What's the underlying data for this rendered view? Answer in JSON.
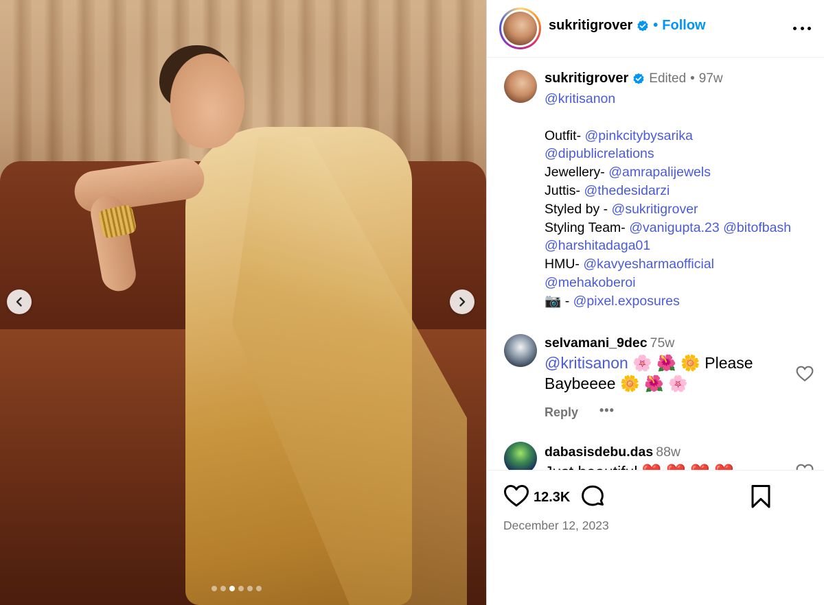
{
  "post": {
    "username": "sukritigrover",
    "follow_label": "Follow",
    "header_separator": "•",
    "caption": {
      "username": "sukritigrover",
      "edited_label": "Edited",
      "separator": "•",
      "age": "97w",
      "lines": [
        [
          {
            "t": "@kritisanon",
            "m": true
          }
        ],
        [
          {
            "t": "",
            "m": false
          }
        ],
        [
          {
            "t": "Outfit- ",
            "m": false
          },
          {
            "t": "@pinkcitybysarika",
            "m": true
          }
        ],
        [
          {
            "t": "@dipublicrelations",
            "m": true
          }
        ],
        [
          {
            "t": "Jewellery- ",
            "m": false
          },
          {
            "t": "@amrapalijewels",
            "m": true
          }
        ],
        [
          {
            "t": "Juttis- ",
            "m": false
          },
          {
            "t": "@thedesidarzi",
            "m": true
          }
        ],
        [
          {
            "t": "Styled by - ",
            "m": false
          },
          {
            "t": "@sukritigrover",
            "m": true
          }
        ],
        [
          {
            "t": "Styling Team- ",
            "m": false
          },
          {
            "t": "@vanigupta.23",
            "m": true
          },
          {
            "t": " ",
            "m": false
          },
          {
            "t": "@bitofbash",
            "m": true
          }
        ],
        [
          {
            "t": "@harshitadaga01",
            "m": true
          }
        ],
        [
          {
            "t": "HMU- ",
            "m": false
          },
          {
            "t": "@kavyesharmaofficial",
            "m": true
          }
        ],
        [
          {
            "t": "@mehakoberoi",
            "m": true
          }
        ],
        [
          {
            "t": "📷 - ",
            "m": false
          },
          {
            "t": "@pixel.exposures",
            "m": true
          }
        ]
      ]
    },
    "comments": [
      {
        "username": "selvamani_9dec",
        "age": "75w",
        "mention": "@kritisanon",
        "text": " 🌸 🌺 🌼 Please Baybeeee 🌼 🌺 🌸",
        "reply_label": "Reply",
        "more_label": "•••"
      },
      {
        "username": "dabasisdebu.das",
        "age": "88w",
        "text": "Just beautiful ❤️ ❤️ ❤️ ❤️"
      }
    ],
    "likes": "12.3K",
    "date": "December 12, 2023",
    "carousel": {
      "count": 6,
      "active_index": 2
    }
  },
  "colors": {
    "link": "#4a5bd8",
    "follow": "#0095f6",
    "muted": "#737373",
    "verified": "#0095f6"
  },
  "icons": {
    "prev": "chevron-left-icon",
    "next": "chevron-right-icon",
    "more": "more-horizontal-icon",
    "like": "heart-outline-icon",
    "comment": "comment-bubble-icon",
    "save": "bookmark-icon",
    "verified": "verified-badge-icon"
  }
}
